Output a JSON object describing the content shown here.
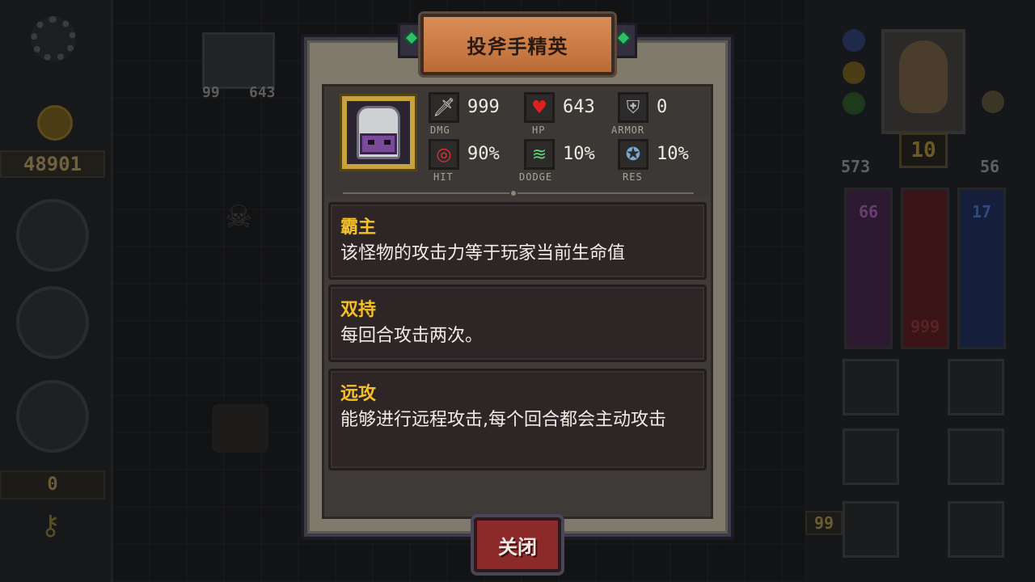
{
  "background": {
    "left_panel": {
      "gold": "48901",
      "keys": "0"
    },
    "map": {
      "monster_dmg": "99",
      "monster_hp": "643"
    },
    "right_panel": {
      "level": "10",
      "attack": "573",
      "defense": "56",
      "mana": "66",
      "health": "999",
      "energy": "17",
      "potion_count": "99"
    }
  },
  "modal": {
    "title": "投斧手精英",
    "stats": [
      {
        "icon": "sword-icon",
        "value": "999",
        "label": "DMG"
      },
      {
        "icon": "heart-icon",
        "value": "643",
        "label": "HP"
      },
      {
        "icon": "shield-icon",
        "value": "0",
        "label": "ARMOR"
      },
      {
        "icon": "target-icon",
        "value": "90%",
        "label": "HIT"
      },
      {
        "icon": "tornado-icon",
        "value": "10%",
        "label": "DODGE"
      },
      {
        "icon": "resist-icon",
        "value": "10%",
        "label": "RES"
      }
    ],
    "traits": [
      {
        "name": "霸主",
        "desc": "该怪物的攻击力等于玩家当前生命值"
      },
      {
        "name": "双持",
        "desc": "每回合攻击两次。"
      },
      {
        "name": "远攻",
        "desc": "能够进行远程攻击,每个回合都会主动攻击"
      }
    ],
    "close_label": "关闭"
  },
  "colors": {
    "trait_title": "#f4c02a",
    "title_plate": "#c97a44",
    "close_button": "#8c2a2a"
  }
}
